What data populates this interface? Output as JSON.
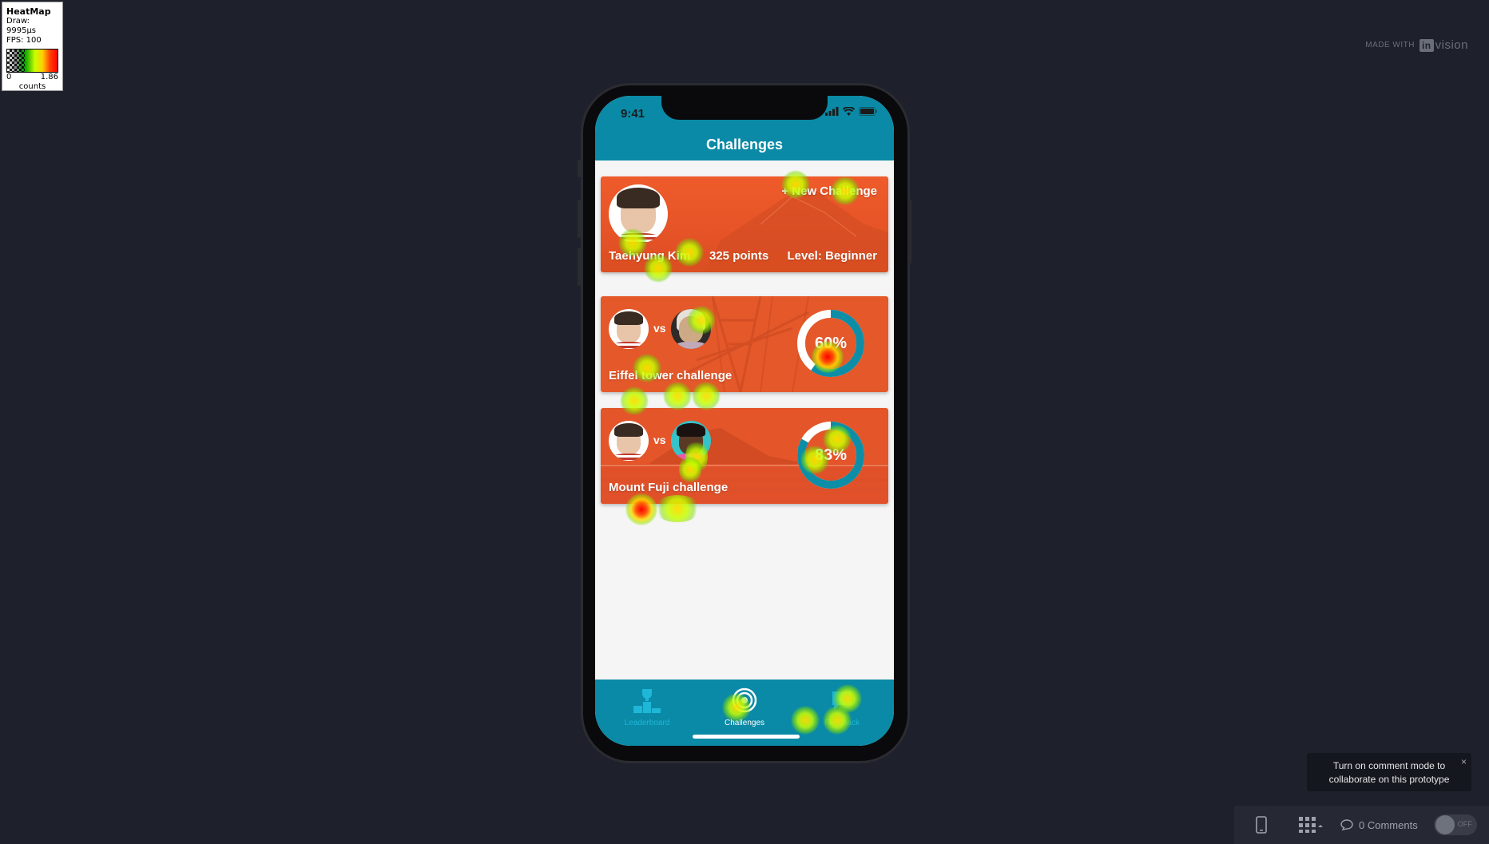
{
  "heatmap_legend": {
    "title": "HeatMap",
    "draw": "Draw: 9995µs",
    "fps": "FPS: 100",
    "min": "0",
    "max": "1.86",
    "unit": "counts"
  },
  "branding": {
    "made_with": "MADE WITH",
    "logo_box": "in",
    "logo_text": "vision"
  },
  "phone": {
    "status_time": "9:41",
    "header_title": "Challenges",
    "profile": {
      "name": "Taehyung Kim",
      "points": "325 points",
      "level": "Level: Beginner",
      "new_challenge": "+ New Challenge"
    },
    "challenges": [
      {
        "vs": "vs",
        "title": "Eiffel tower challenge",
        "progress_label": "60%",
        "progress": 0.6
      },
      {
        "vs": "vs",
        "title": "Mount Fuji challenge",
        "progress_label": "83%",
        "progress": 0.83
      }
    ],
    "tabs": [
      {
        "label": "Leaderboard",
        "icon": "trophy-podium-icon",
        "active": false
      },
      {
        "label": "Challenges",
        "icon": "target-icon",
        "active": true
      },
      {
        "label": "Feedback",
        "icon": "feedback-icon",
        "active": false
      }
    ]
  },
  "comment_hint": {
    "line1": "Turn on comment mode to",
    "line2": "collaborate on this prototype",
    "close": "×"
  },
  "bottom_bar": {
    "comments": "0 Comments",
    "toggle_label": "OFF"
  },
  "colors": {
    "background": "#1e212b",
    "teal": "#0a8aa6",
    "card_orange": "#e35b2e",
    "ring_teal": "#0d8ea6"
  }
}
